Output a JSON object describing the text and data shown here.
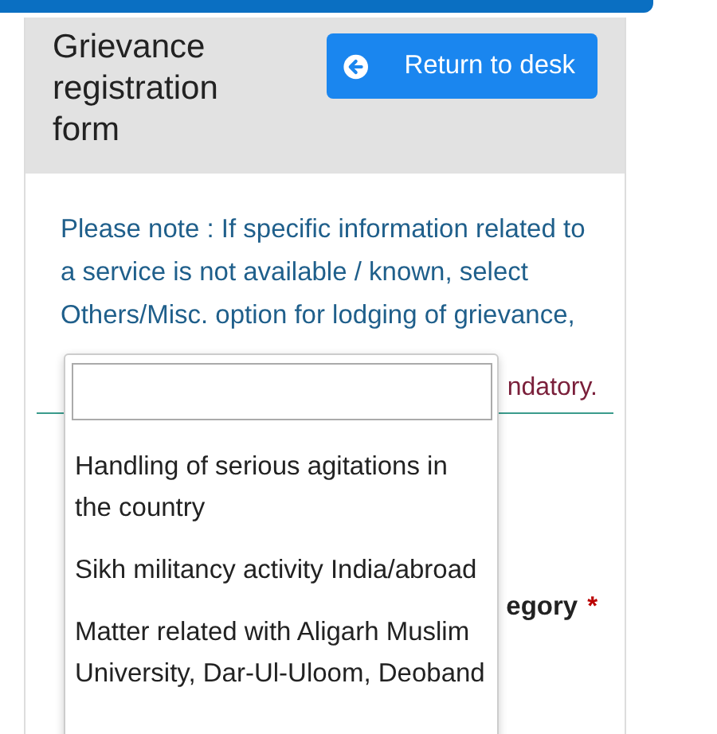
{
  "header": {
    "title": "Grievance registration form",
    "return_button": "Return to desk"
  },
  "note": "Please note : If specific information related to a service is not available / known, select Others/Misc. option for lodging of grievance,",
  "mandatory_fragment": "ndatory.",
  "field_label": {
    "text": "egory",
    "required_mark": "*"
  },
  "dropdown": {
    "options": [
      {
        "label": "Handling of serious agitations in the country"
      },
      {
        "label": "Sikh militancy activity India/abroad"
      },
      {
        "label": "Matter related with Aligarh Muslim University, Dar-Ul-Uloom, Deoband"
      }
    ]
  }
}
